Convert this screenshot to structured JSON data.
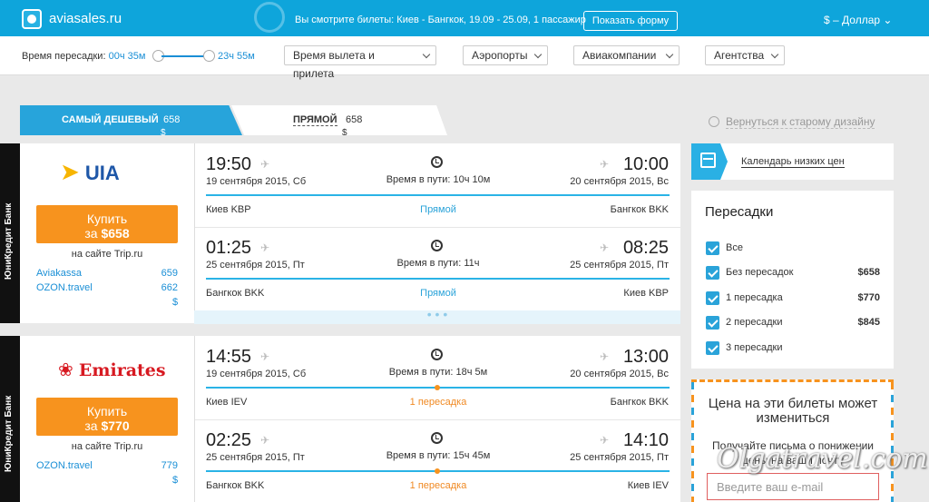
{
  "topbar": {
    "brand": "aviasales.ru",
    "viewing": "Вы смотрите билеты: Киев - Бангкок, 19.09 - 25.09, 1 пассажир",
    "show_form": "Показать форму",
    "currency": "$ – Доллар"
  },
  "filters": {
    "layover_label": "Время пересадки:",
    "layover_min": "00ч 35м",
    "layover_max": "23ч 55м",
    "departure_arrival": "Время вылета и прилета",
    "airports": "Аэропорты",
    "airlines": "Авиакомпании",
    "agencies": "Агентства"
  },
  "tabs": {
    "cheapest_label": "САМЫЙ ДЕШЕВЫЙ",
    "cheapest_price": "658",
    "cheapest_cur": "$",
    "direct_label": "ПРЯМОЙ",
    "direct_price": "658",
    "direct_cur": "$"
  },
  "old_design": "Вернуться к старому дизайну",
  "bank_label": "ЮниКредит Банк",
  "cards": [
    {
      "airline": "UIA",
      "buy_label": "Купить",
      "buy_prefix": "за",
      "buy_price": "$658",
      "site": "на сайте Trip.ru",
      "agencies": [
        {
          "name": "Aviakassa",
          "price": "659"
        },
        {
          "name": "OZON.travel",
          "price": "662"
        }
      ],
      "agency_currency": "$",
      "segments": [
        {
          "dep_time": "19:50",
          "dep_date": "19 сентября 2015, Сб",
          "dep_city": "Киев KBP",
          "arr_time": "10:00",
          "arr_date": "20 сентября 2015, Вс",
          "arr_city": "Бангкок BKK",
          "duration": "Время в пути: 10ч 10м",
          "stops": "Прямой"
        },
        {
          "dep_time": "01:25",
          "dep_date": "25 сентября 2015, Пт",
          "dep_city": "Бангкок BKK",
          "arr_time": "08:25",
          "arr_date": "25 сентября 2015, Пт",
          "arr_city": "Киев KBP",
          "duration": "Время в пути: 11ч",
          "stops": "Прямой"
        }
      ],
      "more": "• • •"
    },
    {
      "airline": "Emirates",
      "buy_label": "Купить",
      "buy_prefix": "за",
      "buy_price": "$770",
      "site": "на сайте Trip.ru",
      "agencies": [
        {
          "name": "OZON.travel",
          "price": "779"
        }
      ],
      "agency_currency": "$",
      "segments": [
        {
          "dep_time": "14:55",
          "dep_date": "19 сентября 2015, Сб",
          "dep_city": "Киев IEV",
          "arr_time": "13:00",
          "arr_date": "20 сентября 2015, Вс",
          "arr_city": "Бангкок BKK",
          "duration": "Время в пути: 18ч 5м",
          "stops": "1 пересадка"
        },
        {
          "dep_time": "02:25",
          "dep_date": "25 сентября 2015, Пт",
          "dep_city": "Бангкок BKK",
          "arr_time": "14:10",
          "arr_date": "25 сентября 2015, Пт",
          "arr_city": "Киев IEV",
          "duration": "Время в пути: 15ч 45м",
          "stops": "1 пересадка"
        }
      ]
    }
  ],
  "sidebar": {
    "calendar_link": "Календарь низких цен",
    "stops_title": "Пересадки",
    "stops": [
      {
        "label": "Все",
        "price": ""
      },
      {
        "label": "Без пересадок",
        "price": "$658"
      },
      {
        "label": "1 пересадка",
        "price": "$770"
      },
      {
        "label": "2 пересадки",
        "price": "$845"
      },
      {
        "label": "3 пересадки",
        "price": ""
      }
    ],
    "notify_title": "Цена на эти билеты может измениться",
    "notify_text": "Получайте письма о понижении цены на ваши почту",
    "email_placeholder": "Введите ваш e-mail"
  },
  "watermark": "Olgatravel.com",
  "colors": {
    "topbar": "#0ea5db",
    "buy": "#f7931e",
    "accent": "#2aa3d9"
  }
}
